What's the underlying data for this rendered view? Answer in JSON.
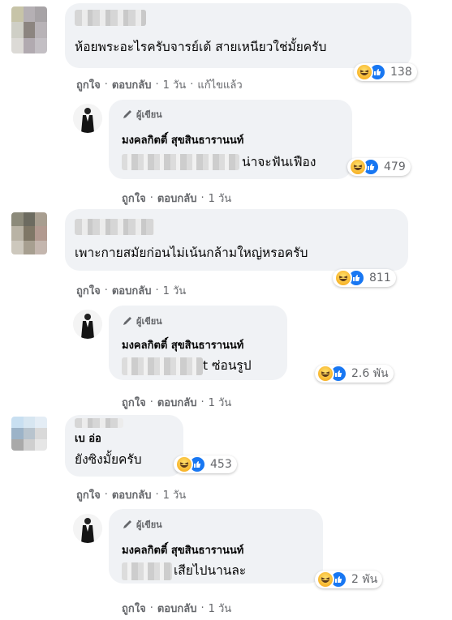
{
  "reply_labels": {
    "like": "ถูกใจ",
    "reply": "ตอบกลับ",
    "dot": "·"
  },
  "author_badge": "ผู้เขียน",
  "page_name": "มงคลกิตติ์ สุขสินธารานนท์",
  "comments": [
    {
      "text": "ห้อยพระอะไรครับจารย์เต้ สายเหนียวใช่มั้ยครับ",
      "reaction_count": "138",
      "time": "1 วัน",
      "edited": "แก้ไขแล้ว",
      "reply": {
        "text": "น่าจะฟันเฟือง",
        "reaction_count": "479",
        "time": "1 วัน"
      }
    },
    {
      "text": "เพาะกายสมัยก่อนไม่เน้นกล้ามใหญ่หรอครับ",
      "reaction_count": "811",
      "time": "1 วัน",
      "reply": {
        "text": "t ซ่อนรูป",
        "reaction_count": "2.6 พัน",
        "time": "1 วัน"
      }
    },
    {
      "name_partial": "เบ อ่อ",
      "text": "ยังซิงมั้ยครับ",
      "reaction_count": "453",
      "time": "1 วัน",
      "reply": {
        "text": "เสียไปนานละ",
        "reaction_count": "2 พัน",
        "time": "1 วัน"
      }
    }
  ],
  "icons": {
    "reaction_haha": "haha-emoji",
    "reaction_like": "thumbs-up",
    "author": "pen-icon"
  },
  "colors": {
    "bubble": "#f0f2f5",
    "meta_text": "#65676b",
    "like_blue": "#1877f2",
    "haha_yellow": "#f7b125"
  }
}
